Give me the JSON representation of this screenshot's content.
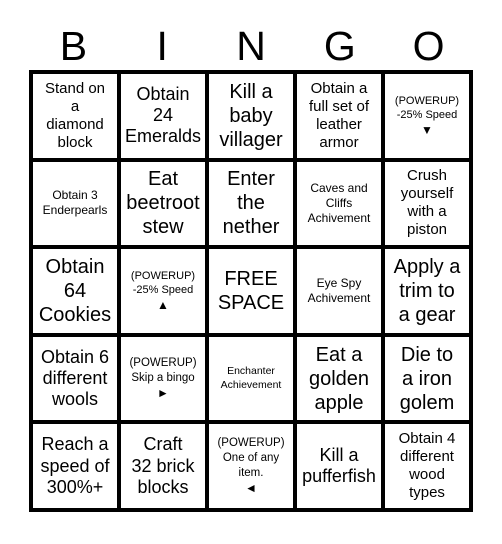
{
  "header": {
    "letters": [
      "B",
      "I",
      "N",
      "G",
      "O"
    ]
  },
  "colors": {
    "grid_line": "#000000",
    "cell_background": "#ffffff",
    "text": "#000000"
  },
  "grid": {
    "columns": 5,
    "rows": 5,
    "cells": [
      {
        "text": "Stand on\na\ndiamond\nblock",
        "size": "md",
        "type": "task"
      },
      {
        "text": "Obtain\n24\nEmeralds",
        "size": "lg",
        "type": "task"
      },
      {
        "text": "Kill a\nbaby\nvillager",
        "size": "xl",
        "type": "task"
      },
      {
        "text": "Obtain a\nfull set of\nleather\narmor",
        "size": "md",
        "type": "task"
      },
      {
        "title": "(POWERUP)",
        "desc": "-25% Speed",
        "arrow": "▼",
        "arrow_name": "arrow-down-icon",
        "size": "sm",
        "type": "powerup"
      },
      {
        "text": "Obtain 3\nEnderpearls",
        "size": "sm",
        "type": "task"
      },
      {
        "text": "Eat\nbeetroot\nstew",
        "size": "xl",
        "type": "task"
      },
      {
        "text": "Enter\nthe\nnether",
        "size": "xl",
        "type": "task"
      },
      {
        "text": "Caves and\nCliffs\nAchivement",
        "size": "sm",
        "type": "task"
      },
      {
        "text": "Crush\nyourself\nwith a\npiston",
        "size": "md",
        "type": "task"
      },
      {
        "text": "Obtain\n64\nCookies",
        "size": "xl",
        "type": "task"
      },
      {
        "title": "(POWERUP)",
        "desc": "-25% Speed",
        "arrow": "▲",
        "arrow_name": "arrow-up-icon",
        "size": "sm",
        "type": "powerup"
      },
      {
        "text": "FREE\nSPACE",
        "size": "xl",
        "type": "free"
      },
      {
        "text": "Eye Spy\nAchivement",
        "size": "sm",
        "type": "task"
      },
      {
        "text": "Apply a\ntrim to\na gear",
        "size": "xl",
        "type": "task"
      },
      {
        "text": "Obtain 6\ndifferent\nwools",
        "size": "lg",
        "type": "task"
      },
      {
        "title": "(POWERUP)",
        "desc": "Skip a bingo",
        "arrow": "►",
        "arrow_name": "arrow-right-icon",
        "size": "sm",
        "type": "powerup"
      },
      {
        "text": "Enchanter\nAchievement",
        "size": "xs",
        "type": "task"
      },
      {
        "text": "Eat a\ngolden\napple",
        "size": "xl",
        "type": "task"
      },
      {
        "text": "Die to\na iron\ngolem",
        "size": "xl",
        "type": "task"
      },
      {
        "text": "Reach a\nspeed of\n300%+",
        "size": "lg",
        "type": "task"
      },
      {
        "text": "Craft\n32 brick\nblocks",
        "size": "lg",
        "type": "task"
      },
      {
        "title": "(POWERUP)",
        "desc": "One of any\nitem.",
        "arrow": "◄",
        "arrow_name": "arrow-left-icon",
        "size": "sm",
        "type": "powerup"
      },
      {
        "text": "Kill a\npufferfish",
        "size": "lg",
        "type": "task"
      },
      {
        "text": "Obtain 4\ndifferent\nwood\ntypes",
        "size": "md",
        "type": "task"
      }
    ]
  }
}
